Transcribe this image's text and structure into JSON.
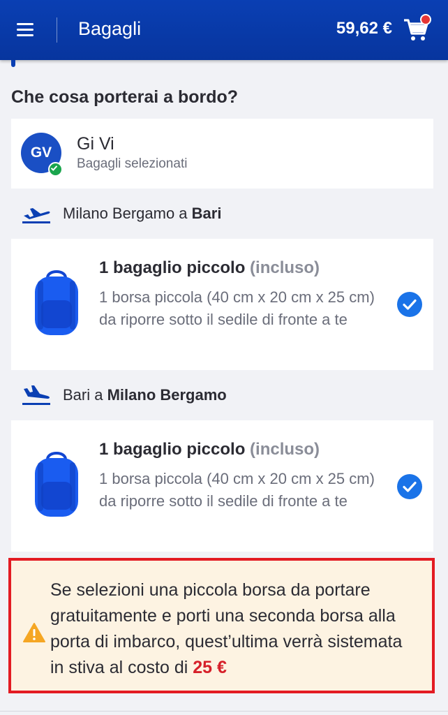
{
  "header": {
    "title": "Bagagli",
    "price": "59,62 €",
    "icons": {
      "menu": "hamburger-menu-icon",
      "cart": "shopping-cart-icon"
    }
  },
  "section_heading": "Che cosa porterai a bordo?",
  "passenger": {
    "initials": "GV",
    "name": "Gi Vi",
    "status": "Bagagli selezionati"
  },
  "flights": [
    {
      "route_from": "Milano Bergamo a ",
      "route_to": "Bari",
      "bag_title": "1 bagaglio piccolo",
      "bag_note": "(incluso)",
      "bag_desc": "1 borsa piccola (40 cm x 20 cm x 25 cm) da riporre sotto il sedile di fronte a te",
      "selected": true
    },
    {
      "route_from": "Bari a ",
      "route_to": "Milano Bergamo",
      "bag_title": "1 bagaglio piccolo",
      "bag_note": "(incluso)",
      "bag_desc": "1 borsa piccola (40 cm x 20 cm x 25 cm) da riporre sotto il sedile di fronte a te",
      "selected": true
    }
  ],
  "warning": {
    "text": "Se selezioni una piccola borsa da portare gratuitamente e porti una seconda borsa alla porta di imbarco, quest’ultima verrà sistemata in stiva al costo di ",
    "cost": "25 €"
  },
  "colors": {
    "header_bg": "#0a3fb3",
    "check": "#1a73e8",
    "warning_border": "#e31b23",
    "warning_bg": "#fdf3e2",
    "cost": "#d6202a"
  }
}
